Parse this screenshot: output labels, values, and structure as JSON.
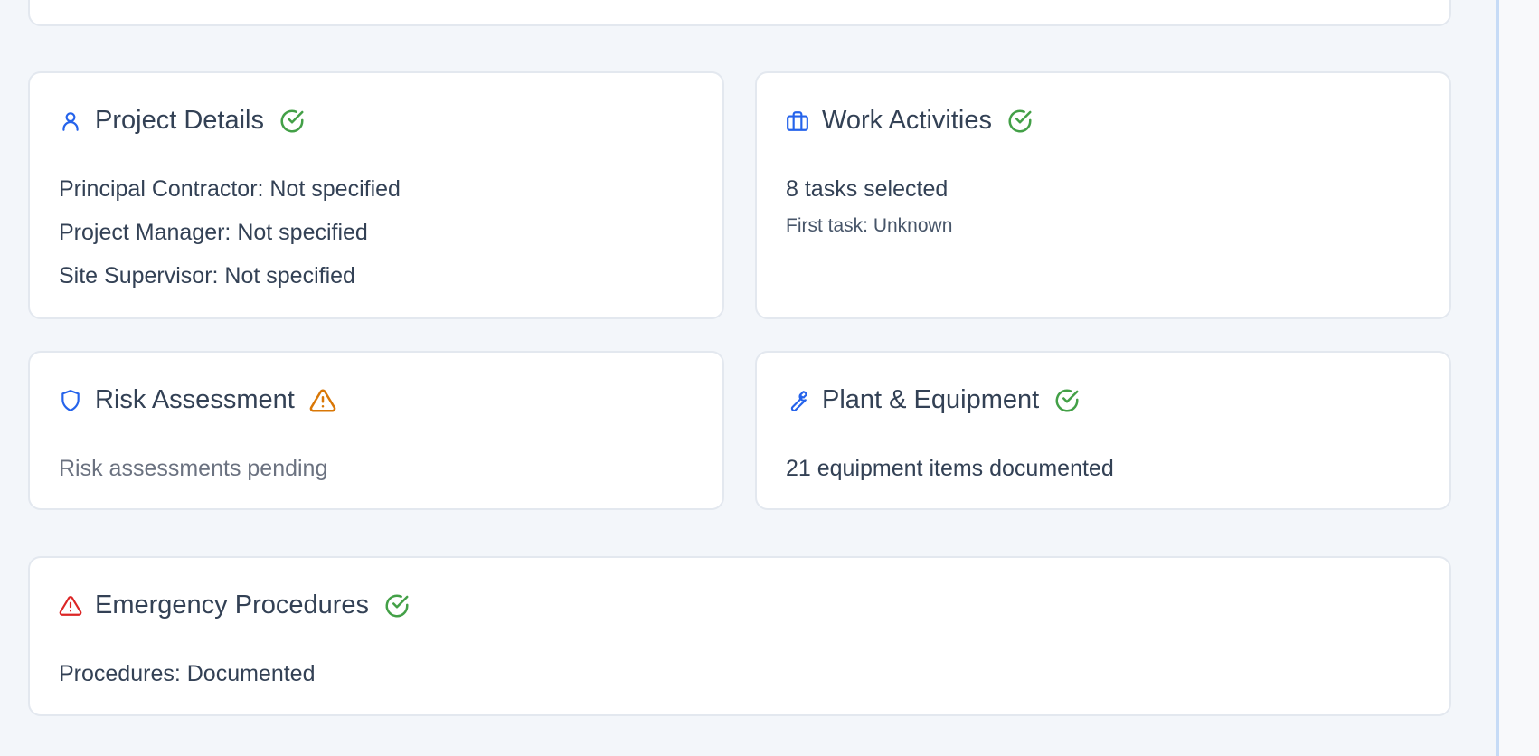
{
  "cards": {
    "project": {
      "title": "Project Details",
      "status": "complete",
      "lines": [
        "Principal Contractor: Not specified",
        "Project Manager: Not specified",
        "Site Supervisor: Not specified"
      ]
    },
    "work": {
      "title": "Work Activities",
      "status": "complete",
      "summary": "8 tasks selected",
      "detail": "First task: Unknown"
    },
    "risk": {
      "title": "Risk Assessment",
      "status": "warning",
      "summary": "Risk assessments pending"
    },
    "plant": {
      "title": "Plant & Equipment",
      "status": "complete",
      "summary": "21 equipment items documented"
    },
    "emergency": {
      "title": "Emergency Procedures",
      "status": "complete",
      "summary": "Procedures: Documented"
    }
  },
  "colors": {
    "accent": "#2563eb",
    "success": "#43a047",
    "warning": "#d97706",
    "danger": "#dc2626",
    "text": "#334155"
  }
}
